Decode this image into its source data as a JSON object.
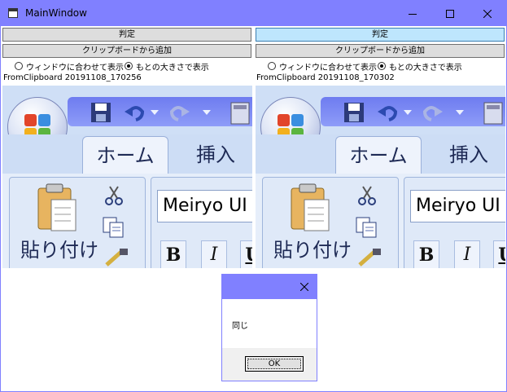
{
  "window": {
    "title": "MainWindow"
  },
  "panes": [
    {
      "judge_label": "判定",
      "add_label": "クリップボードから追加",
      "radio_fit_label": "ウィンドウに合わせて表示",
      "radio_original_label": "もとの大きさで表示",
      "selected_mode": "original",
      "caption": "FromClipboard 20191108_170256",
      "preview": {
        "tab_home": "ホーム",
        "tab_insert": "挿入",
        "font_name": "Meiryo UI",
        "paste_label": "貼り付け",
        "bold": "B",
        "italic": "I",
        "underline": "U"
      }
    },
    {
      "judge_label": "判定",
      "add_label": "クリップボードから追加",
      "radio_fit_label": "ウィンドウに合わせて表示",
      "radio_original_label": "もとの大きさで表示",
      "selected_mode": "original",
      "caption": "FromClipboard 20191108_170302",
      "preview": {
        "tab_home": "ホーム",
        "tab_insert": "挿入",
        "font_name": "Meiryo UI",
        "paste_label": "貼り付け",
        "bold": "B",
        "italic": "I",
        "underline": "U"
      }
    }
  ],
  "dialog": {
    "message": "同じ",
    "ok_label": "OK"
  },
  "colors": {
    "titlebar": "#8080ff",
    "button_face": "#dddddd",
    "button_hover": "#bee6fd"
  }
}
